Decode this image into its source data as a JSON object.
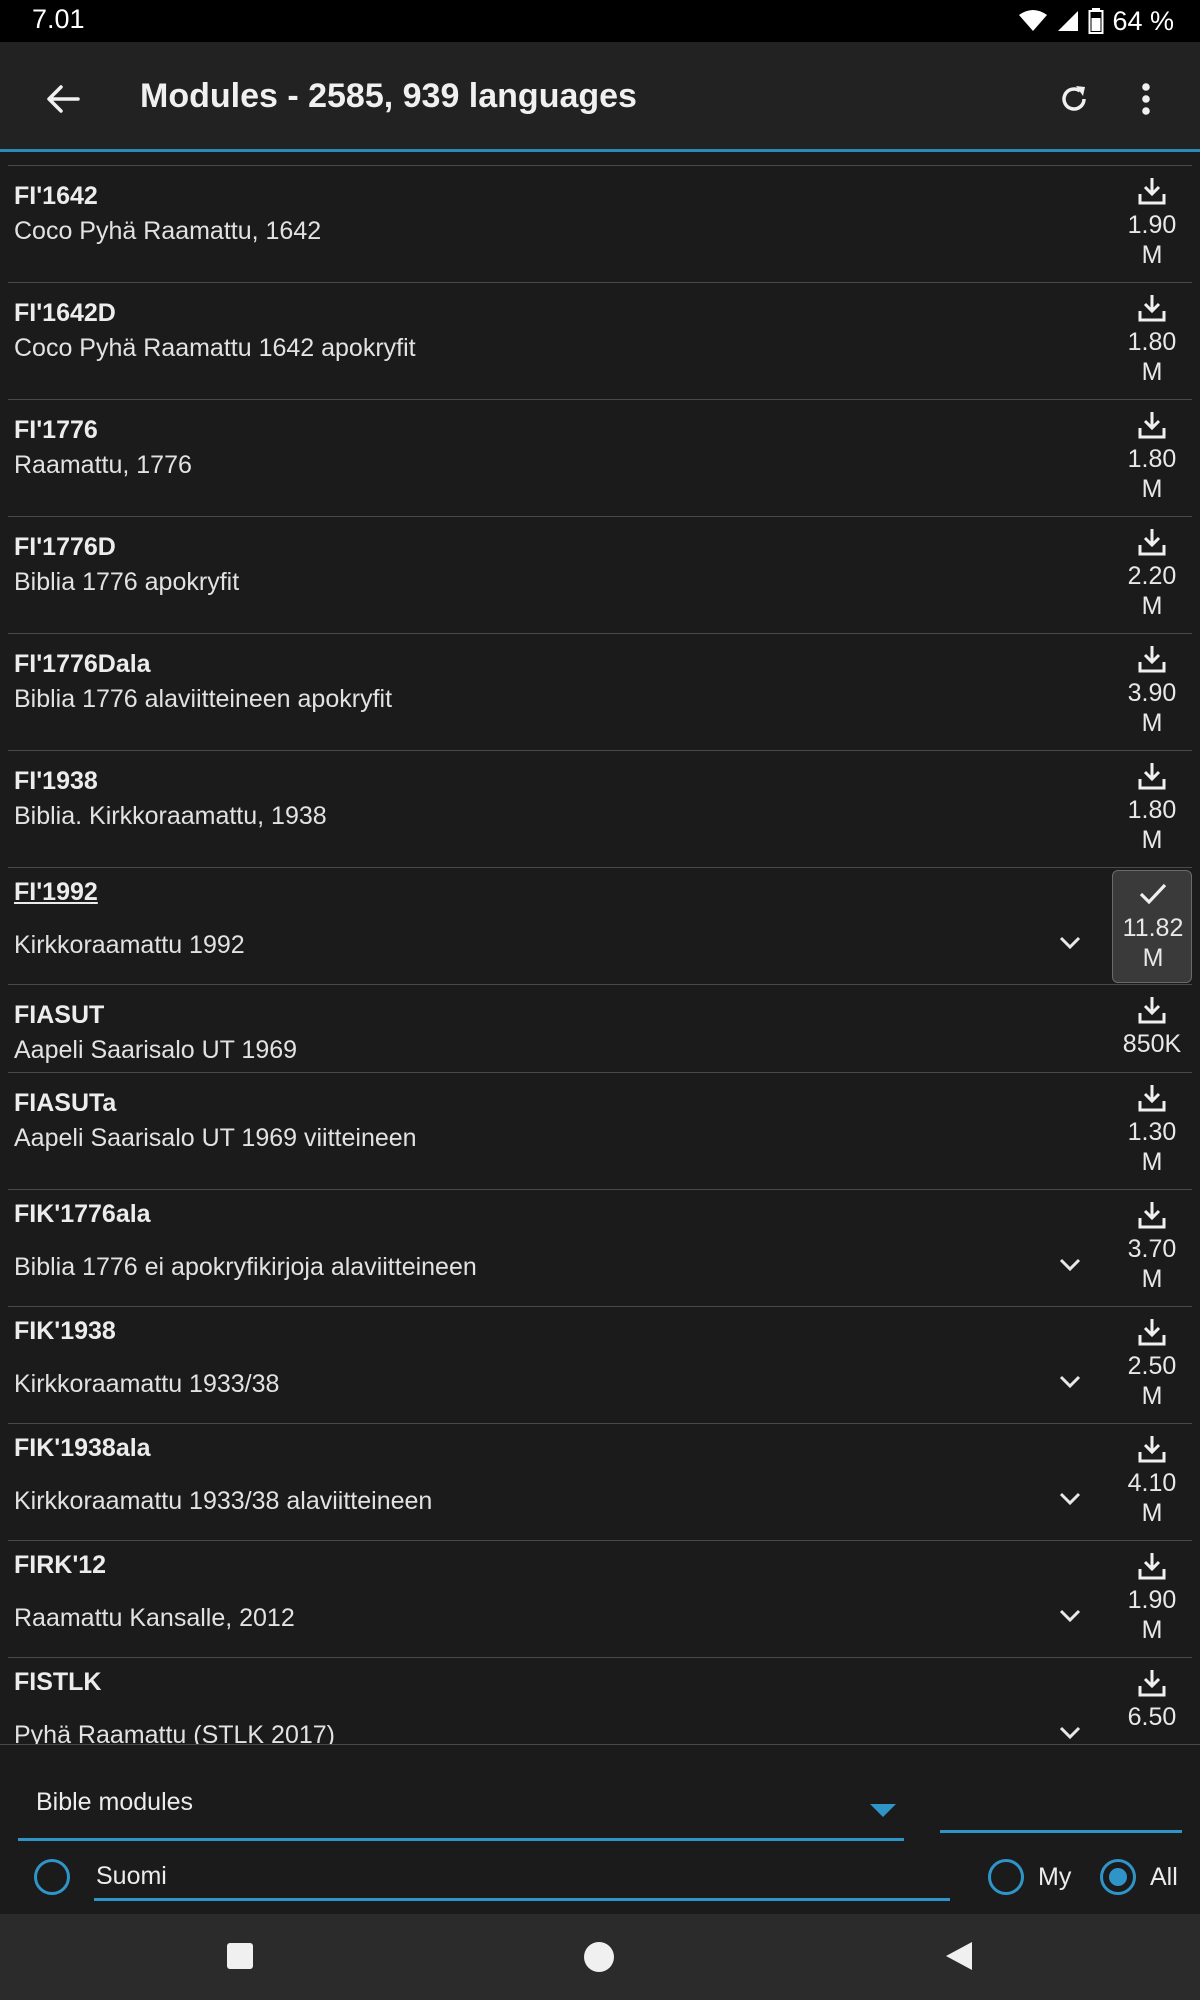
{
  "status": {
    "time": "7.01",
    "battery": "64 %",
    "icons": [
      "wifi-icon",
      "signal-icon",
      "battery-icon"
    ]
  },
  "appbar": {
    "title": "Modules - 2585, 939 languages",
    "icons": [
      "back-arrow-icon",
      "refresh-icon",
      "more-vert-icon"
    ]
  },
  "modules": [
    {
      "name": "FI'1642",
      "description": "Coco Pyhä Raamattu, 1642",
      "size": "1.90\nM",
      "installed": false,
      "expandable": false
    },
    {
      "name": "FI'1642D",
      "description": "Coco Pyhä Raamattu 1642 apokryfit",
      "size": "1.80\nM",
      "installed": false,
      "expandable": false
    },
    {
      "name": "FI'1776",
      "description": "Raamattu, 1776",
      "size": "1.80\nM",
      "installed": false,
      "expandable": false
    },
    {
      "name": "FI'1776D",
      "description": "Biblia 1776 apokryfit",
      "size": "2.20\nM",
      "installed": false,
      "expandable": false
    },
    {
      "name": "FI'1776Dala",
      "description": "Biblia 1776 alaviitteineen apokryfit",
      "size": "3.90\nM",
      "installed": false,
      "expandable": false
    },
    {
      "name": "FI'1938",
      "description": "Biblia. Kirkkoraamattu, 1938",
      "size": "1.80\nM",
      "installed": false,
      "expandable": false
    },
    {
      "name": "FI'1992",
      "description": "Kirkkoraamattu 1992",
      "size": "11.82\nM",
      "installed": true,
      "expandable": true
    },
    {
      "name": "FIASUT",
      "description": "Aapeli Saarisalo UT 1969",
      "size": "850K",
      "installed": false,
      "expandable": false
    },
    {
      "name": "FIASUTa",
      "description": "Aapeli Saarisalo UT 1969 viitteineen",
      "size": "1.30\nM",
      "installed": false,
      "expandable": false
    },
    {
      "name": "FIK'1776ala",
      "description": "Biblia 1776 ei apokryfikirjoja alaviitteineen",
      "size": "3.70\nM",
      "installed": false,
      "expandable": true
    },
    {
      "name": "FIK'1938",
      "description": "Kirkkoraamattu 1933/38",
      "size": "2.50\nM",
      "installed": false,
      "expandable": true
    },
    {
      "name": "FIK'1938ala",
      "description": "Kirkkoraamattu 1933/38 alaviitteineen",
      "size": "4.10\nM",
      "installed": false,
      "expandable": true
    },
    {
      "name": "FIRK'12",
      "description": "Raamattu Kansalle, 2012",
      "size": "1.90\nM",
      "installed": false,
      "expandable": true
    },
    {
      "name": "FISTLK",
      "description": "Pyhä Raamattu (STLK 2017)",
      "size": "6.50",
      "installed": false,
      "expandable": true
    }
  ],
  "filters": {
    "module_type": "Bible modules",
    "search_value": "",
    "language": "Suomi",
    "my_label": "My",
    "all_label": "All",
    "selected_scope": "All"
  },
  "colors": {
    "accent": "#2f95c8",
    "background": "#1b1b1b",
    "appbar": "#222222"
  }
}
